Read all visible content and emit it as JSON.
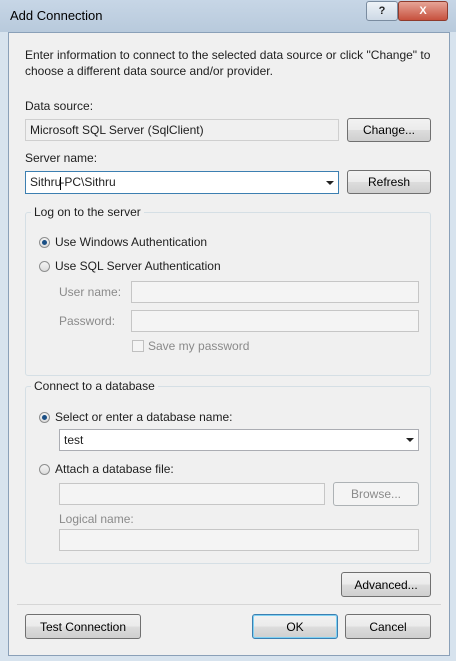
{
  "window": {
    "title": "Add Connection",
    "help_glyph": "?",
    "close_glyph": "X"
  },
  "intro": "Enter information to connect to the selected data source or click \"Change\" to choose a different data source and/or provider.",
  "data_source": {
    "label": "Data source:",
    "value": "Microsoft SQL Server (SqlClient)",
    "change_button": "Change..."
  },
  "server": {
    "label": "Server name:",
    "value_before_caret": "Sithru",
    "value_after_caret": "-PC\\Sithru",
    "refresh_button": "Refresh"
  },
  "logon": {
    "group_title": "Log on to the server",
    "windows_auth": "Use Windows Authentication",
    "sql_auth": "Use SQL Server Authentication",
    "selected": "windows",
    "username_label": "User name:",
    "password_label": "Password:",
    "save_password": "Save my password"
  },
  "database": {
    "group_title": "Connect to a database",
    "select_option": "Select or enter a database name:",
    "selected_db": "test",
    "attach_option": "Attach a database file:",
    "browse_button": "Browse...",
    "logical_name_label": "Logical name:",
    "selected": "select"
  },
  "footer": {
    "advanced_button": "Advanced...",
    "test_button": "Test Connection",
    "ok_button": "OK",
    "cancel_button": "Cancel"
  }
}
